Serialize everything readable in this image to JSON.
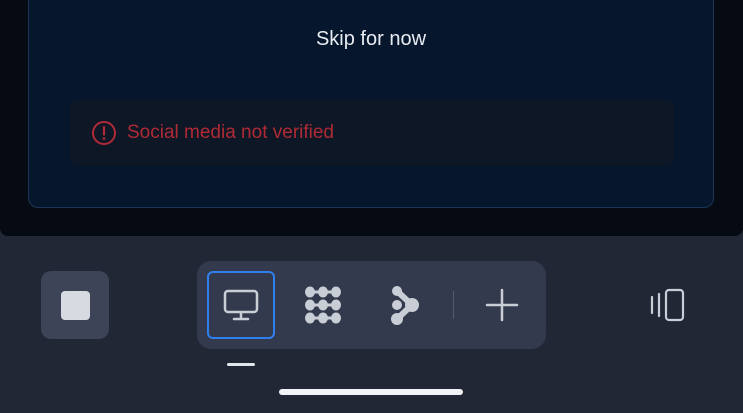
{
  "card": {
    "skip_label": "Skip for now",
    "alert": {
      "icon": "alert-circle-icon",
      "text": "Social media not verified",
      "color": "#b02a35"
    }
  },
  "bottom_bar": {
    "stop_button": {
      "icon": "stop-square-icon"
    },
    "toolbar": {
      "items": [
        {
          "icon": "monitor-icon",
          "active": true
        },
        {
          "icon": "dots-grid-icon",
          "active": false
        },
        {
          "icon": "nodes-flow-icon",
          "active": false
        },
        {
          "icon": "plus-icon",
          "active": false
        }
      ]
    },
    "panel_button": {
      "icon": "panel-toggle-icon"
    }
  },
  "colors": {
    "accent": "#2f80ed",
    "background": "#222736",
    "card_background": "#06172d",
    "error_text": "#b02a35"
  }
}
